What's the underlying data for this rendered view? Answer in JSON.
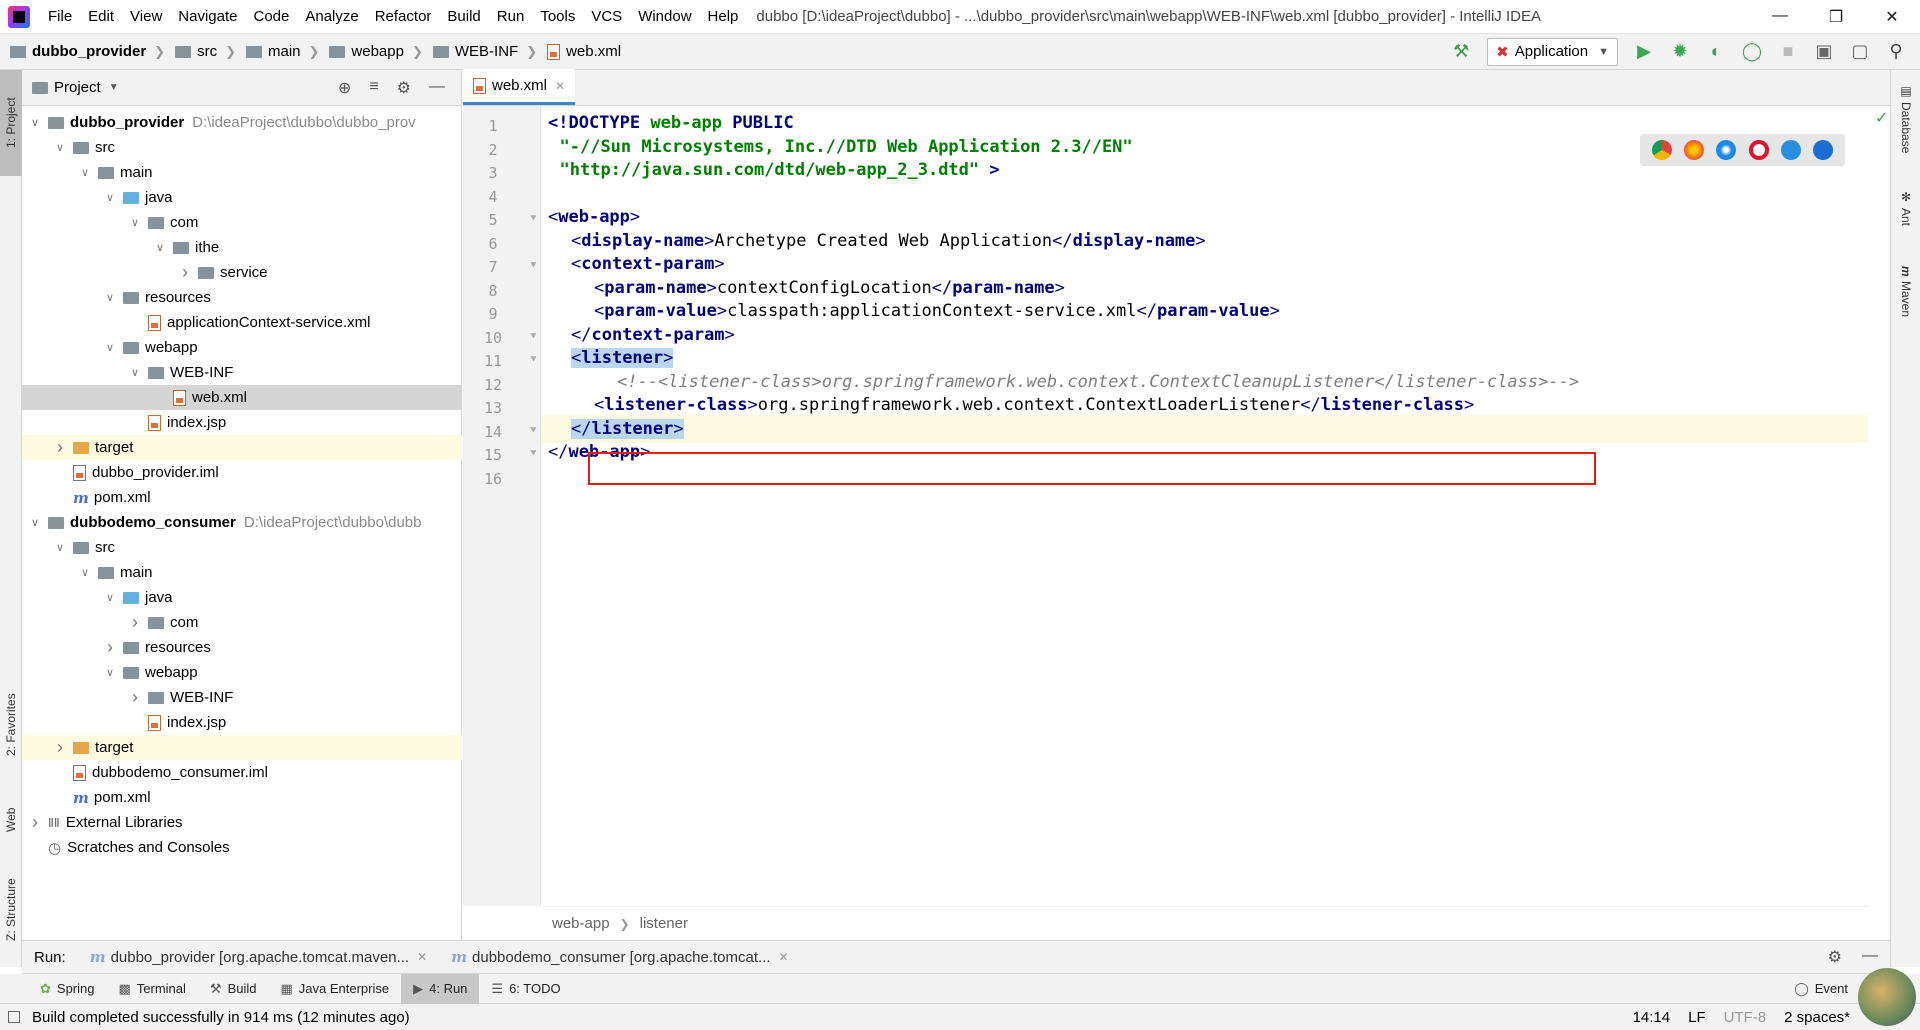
{
  "menu": {
    "items": [
      "File",
      "Edit",
      "View",
      "Navigate",
      "Code",
      "Analyze",
      "Refactor",
      "Build",
      "Run",
      "Tools",
      "VCS",
      "Window",
      "Help"
    ],
    "title": "dubbo [D:\\ideaProject\\dubbo] - ...\\dubbo_provider\\src\\main\\webapp\\WEB-INF\\web.xml [dubbo_provider] - IntelliJ IDEA"
  },
  "navbar": {
    "crumbs": [
      "dubbo_provider",
      "src",
      "main",
      "webapp",
      "WEB-INF",
      "web.xml"
    ],
    "run_config": "Application"
  },
  "left_strip": {
    "project_tab": "1: Project",
    "favorites_tab": "2: Favorites",
    "web_tab": "Web",
    "structure_tab": "Z: Structure"
  },
  "project": {
    "header": "Project",
    "tree": [
      {
        "label": "dubbo_provider",
        "path": "D:\\ideaProject\\dubbo\\dubbo_prov"
      },
      {
        "label": "src"
      },
      {
        "label": "main"
      },
      {
        "label": "java"
      },
      {
        "label": "com"
      },
      {
        "label": "ithe"
      },
      {
        "label": "service"
      },
      {
        "label": "resources"
      },
      {
        "label": "applicationContext-service.xml"
      },
      {
        "label": "webapp"
      },
      {
        "label": "WEB-INF"
      },
      {
        "label": "web.xml"
      },
      {
        "label": "index.jsp"
      },
      {
        "label": "target"
      },
      {
        "label": "dubbo_provider.iml"
      },
      {
        "label": "pom.xml"
      },
      {
        "label": "dubbodemo_consumer",
        "path": "D:\\ideaProject\\dubbo\\dubb"
      },
      {
        "label": "src"
      },
      {
        "label": "main"
      },
      {
        "label": "java"
      },
      {
        "label": "com"
      },
      {
        "label": "resources"
      },
      {
        "label": "webapp"
      },
      {
        "label": "WEB-INF"
      },
      {
        "label": "index.jsp"
      },
      {
        "label": "target"
      },
      {
        "label": "dubbodemo_consumer.iml"
      },
      {
        "label": "pom.xml"
      },
      {
        "label": "External Libraries"
      },
      {
        "label": "Scratches and Consoles"
      }
    ]
  },
  "editor": {
    "tab": "web.xml",
    "line_numbers": [
      "1",
      "2",
      "3",
      "4",
      "5",
      "6",
      "7",
      "8",
      "9",
      "10",
      "11",
      "12",
      "13",
      "14",
      "15",
      "16"
    ],
    "code": {
      "l1_doctype": "<!DOCTYPE",
      "l1_webapp": "web-app",
      "l1_public": "PUBLIC",
      "l2_str": "\"-//Sun Microsystems, Inc.//DTD Web Application 2.3//EN\"",
      "l3_str": "\"http://java.sun.com/dtd/web-app_2_3.dtd\"",
      "l3_end": ">",
      "webapp": "web-app",
      "display_name": "display-name",
      "display_value": "Archetype Created Web Application",
      "context_param": "context-param",
      "param_name": "param-name",
      "param_name_value": "contextConfigLocation",
      "param_value": "param-value",
      "param_value_value": "classpath:applicationContext-service.xml",
      "listener": "listener",
      "comment": "<!--<listener-class>org.springframework.web.context.ContextCleanupListener</listener-class>-->",
      "listener_class": "listener-class",
      "listener_class_value": "org.springframework.web.context.ContextLoaderListener"
    },
    "breadcrumb": [
      "web-app",
      "listener"
    ]
  },
  "right_strip": {
    "database": "Database",
    "ant": "Ant",
    "maven": "Maven"
  },
  "run_bar": {
    "label": "Run:",
    "tabs": [
      "dubbo_provider [org.apache.tomcat.maven...",
      "dubbodemo_consumer [org.apache.tomcat..."
    ]
  },
  "tool_windows": [
    "Spring",
    "Terminal",
    "Build",
    "Java Enterprise",
    "4: Run",
    "6: TODO"
  ],
  "event_label": "Event",
  "status": {
    "message": "Build completed successfully in 914 ms (12 minutes ago)",
    "position": "14:14",
    "line_sep": "LF",
    "encoding": "UTF-8",
    "indent": "2 spaces*"
  }
}
